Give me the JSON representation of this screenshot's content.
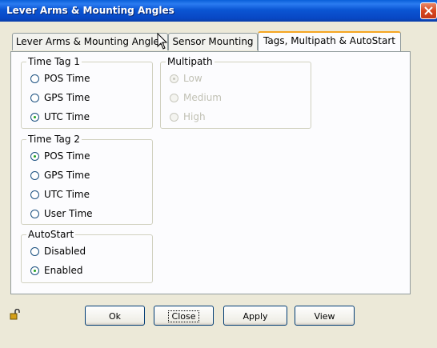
{
  "window": {
    "title": "Lever Arms & Mounting Angles"
  },
  "tabs": [
    {
      "label": "Lever Arms & Mounting Angles"
    },
    {
      "label": "Sensor Mounting"
    },
    {
      "label": "Tags, Multipath & AutoStart",
      "active": true
    }
  ],
  "time_tag_1": {
    "label": "Time Tag 1",
    "options": [
      "POS Time",
      "GPS Time",
      "UTC Time"
    ],
    "selected": "UTC Time"
  },
  "time_tag_2": {
    "label": "Time Tag 2",
    "options": [
      "POS Time",
      "GPS Time",
      "UTC Time",
      "User Time"
    ],
    "selected": "POS Time"
  },
  "autostart": {
    "label": "AutoStart",
    "options": [
      "Disabled",
      "Enabled"
    ],
    "selected": "Enabled"
  },
  "multipath": {
    "label": "Multipath",
    "options": [
      "Low",
      "Medium",
      "High"
    ],
    "selected": "Low",
    "disabled": true
  },
  "buttons": {
    "ok": "Ok",
    "close": "Close",
    "apply": "Apply",
    "view": "View"
  },
  "icons": {
    "lock": "unlocked-padlock-icon",
    "close": "close-icon",
    "cursor": "mouse-pointer-icon"
  },
  "colors": {
    "titlebar": "#0a53d0",
    "close_button": "#d8471f",
    "tab_highlight": "#f5a623",
    "radio_dot": "#21a121"
  }
}
